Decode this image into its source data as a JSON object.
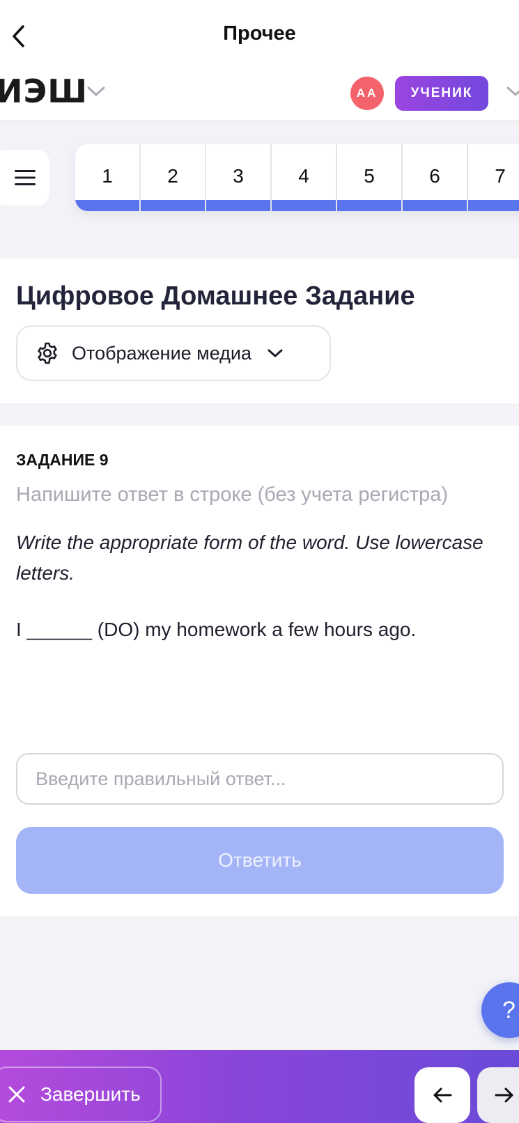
{
  "navbar": {
    "title": "Прочее",
    "back_icon": "chevron-left-icon"
  },
  "header": {
    "logo": "ИЭШ",
    "avatar_initials": "АА",
    "role_badge": "УЧЕНИК"
  },
  "pager": {
    "pages": [
      "1",
      "2",
      "3",
      "4",
      "5",
      "6",
      "7"
    ]
  },
  "title_card": {
    "title": "Цифровое Домашнее Задание",
    "media_button": "Отображение медиа"
  },
  "task": {
    "label": "ЗАДАНИЕ 9",
    "hint": "Напишите ответ в строке (без учета регистра)",
    "instruction": "Write the appropriate form of the word. Use lowercase letters.",
    "sentence": "I ______ (DO) my homework a few hours ago.",
    "input_placeholder": "Введите правильный ответ...",
    "input_value": "",
    "submit_label": "Ответить"
  },
  "help": {
    "label": "?"
  },
  "bottom_bar": {
    "finish_label": "Завершить"
  },
  "colors": {
    "accent_blue": "#5a74ee",
    "avatar_red": "#f4636b",
    "badge_purple": "#8a45d9",
    "submit_disabled": "#a4b5f7"
  }
}
